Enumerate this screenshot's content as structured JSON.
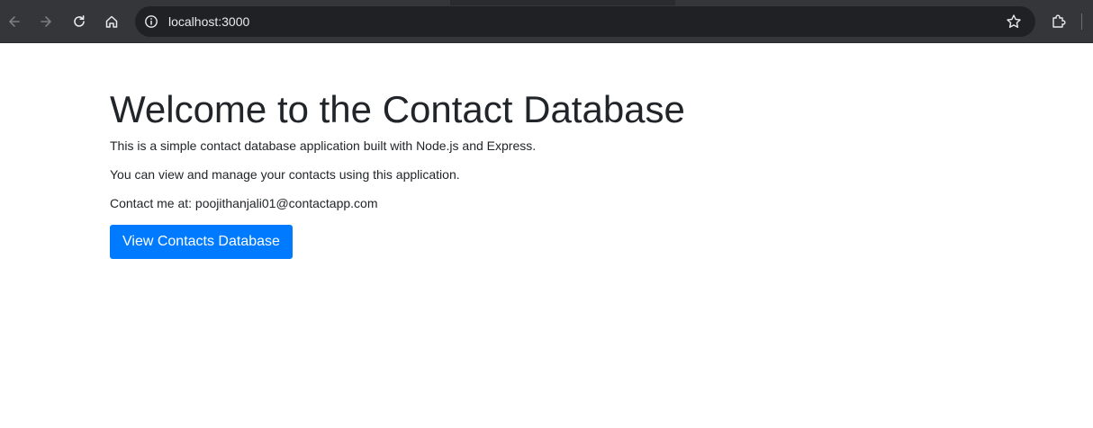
{
  "browser": {
    "url": "localhost:3000",
    "icons": {
      "back": "arrow-left-icon",
      "forward": "arrow-right-icon",
      "reload": "reload-icon",
      "home": "home-icon",
      "site_info": "info-icon",
      "bookmark": "star-icon",
      "extensions": "puzzle-icon"
    },
    "colors": {
      "chrome": "#35363a",
      "omnibox": "#202124",
      "icon": "#e8eaed",
      "icon_disabled": "#7c7d80"
    }
  },
  "page": {
    "title": "Welcome to the Contact Database",
    "description": "This is a simple contact database application built with Node.js and Express.",
    "manage_text": "You can view and manage your contacts using this application.",
    "contact_text": "Contact me at: poojithanjali01@contactapp.com",
    "cta_label": "View Contacts Database",
    "colors": {
      "text": "#212529",
      "primary": "#007bff"
    }
  }
}
